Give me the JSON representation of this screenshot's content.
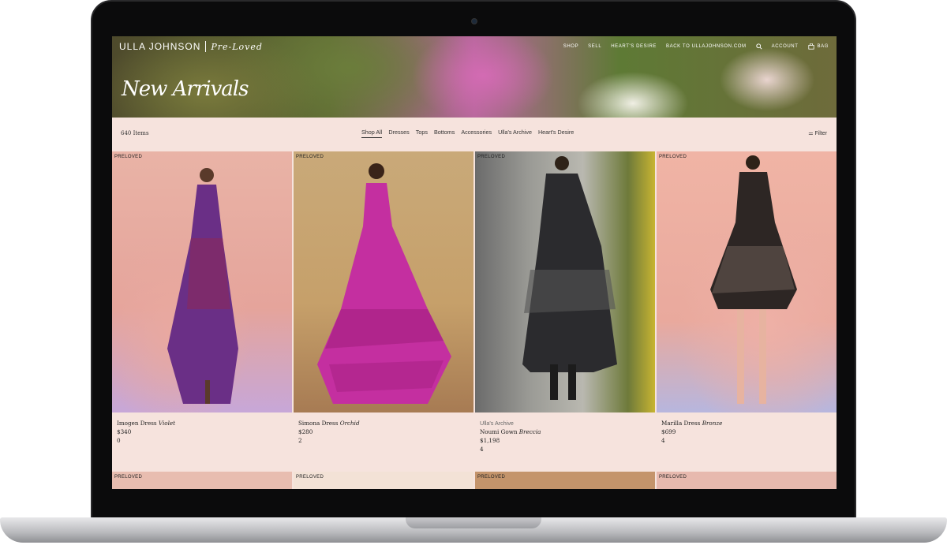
{
  "brand": {
    "name": "ULLA JOHNSON",
    "sub": "Pre-Loved"
  },
  "nav": {
    "shop": "SHOP",
    "sell": "SELL",
    "hearts_desire": "HEART'S DESIRE",
    "back": "BACK TO ULLAJOHNSON.COM",
    "account": "ACCOUNT",
    "bag": "BAG"
  },
  "hero": {
    "title": "New Arrivals"
  },
  "filters": {
    "count": "640 Items",
    "categories": [
      "Shop All",
      "Dresses",
      "Tops",
      "Bottoms",
      "Accessories",
      "Ulla's Archive",
      "Heart's Desire"
    ],
    "active": "Shop All",
    "filter_label": "Filter"
  },
  "products": [
    {
      "badge": "PRELOVED",
      "archive": "",
      "name": "Imogen Dress",
      "color": "Violet",
      "price": "$340",
      "qty": "0"
    },
    {
      "badge": "PRELOVED",
      "archive": "",
      "name": "Simona Dress",
      "color": "Orchid",
      "price": "$280",
      "qty": "2"
    },
    {
      "badge": "PRELOVED",
      "archive": "Ulla's Archive",
      "name": "Noumi Gown",
      "color": "Breccia",
      "price": "$1,198",
      "qty": "4"
    },
    {
      "badge": "PRELOVED",
      "archive": "",
      "name": "Marilla Dress",
      "color": "Bronze",
      "price": "$699",
      "qty": "4"
    }
  ],
  "row2_badges": [
    "PRELOVED",
    "PRELOVED",
    "PRELOVED",
    "PRELOVED"
  ]
}
